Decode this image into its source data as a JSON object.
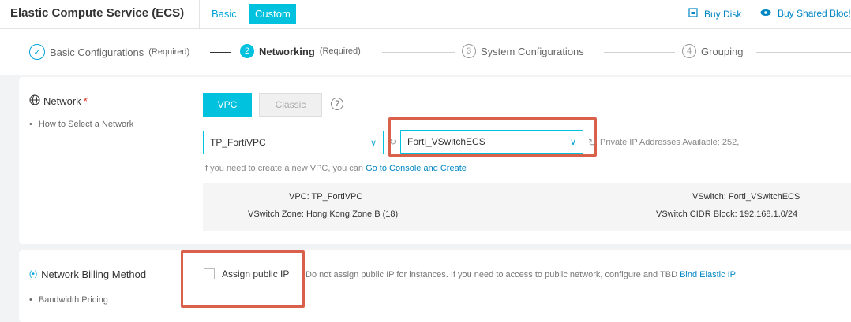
{
  "header": {
    "title": "Elastic Compute Service (ECS)",
    "tabs": [
      "Basic",
      "Custom"
    ],
    "buy_disk": "Buy Disk",
    "buy_shared": "Buy Shared Bloc!"
  },
  "steps": [
    {
      "num": "✓",
      "label": "Basic Configurations",
      "req": "(Required)"
    },
    {
      "num": "2",
      "label": "Networking",
      "req": "(Required)"
    },
    {
      "num": "3",
      "label": "System Configurations"
    },
    {
      "num": "4",
      "label": "Grouping"
    }
  ],
  "network": {
    "title": "Network",
    "star": "*",
    "sub": "How to Select a Network",
    "vpc_btn": "VPC",
    "classic_btn": "Classic",
    "help": "?",
    "vpc_select": "TP_FortiVPC",
    "vswitch_select": "Forti_VSwitchECS",
    "private_ip": "Private IP Addresses Available: 252,",
    "create_hint": "If you need to create a new VPC, you can",
    "create_link": "Go to Console and Create",
    "info": {
      "vpc_label": "VPC:",
      "vpc_value": "TP_FortiVPC",
      "zone_label": "VSwitch Zone:",
      "zone_value": "Hong Kong Zone B (18)",
      "vswitch_label": "VSwitch:",
      "vswitch_value": "Forti_VSwitchECS",
      "cidr_label": "VSwitch CIDR Block:",
      "cidr_value": "192.168.1.0/24"
    }
  },
  "billing": {
    "title": "Network Billing Method",
    "sub": "Bandwidth Pricing",
    "assign_label": "Assign public IP",
    "hint": "Do not assign public IP for instances. If you need to access to public network, configure and TBD",
    "link": "Bind Elastic IP"
  },
  "colors": {
    "accent": "#00c1de",
    "link": "#0086c3",
    "highlight": "#d9604a"
  }
}
